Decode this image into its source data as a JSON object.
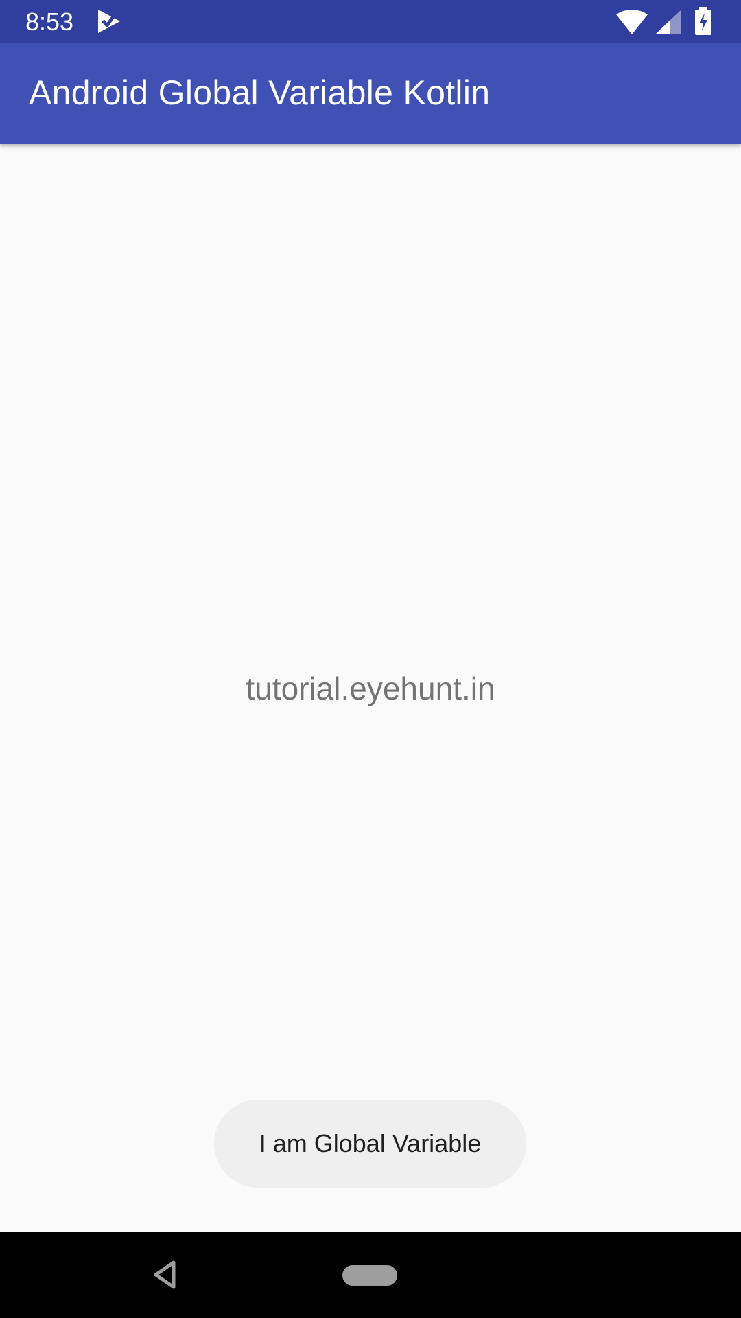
{
  "status_bar": {
    "time": "8:53",
    "icons": [
      "notification-check-icon",
      "wifi-icon",
      "cell-signal-icon",
      "battery-charging-icon"
    ],
    "background_color": "#303f9f"
  },
  "app_bar": {
    "title": "Android Global Variable Kotlin",
    "background_color": "#3f51b5"
  },
  "main": {
    "center_text": "tutorial.eyehunt.in"
  },
  "toast": {
    "message": "I am Global Variable"
  },
  "nav_bar": {
    "icons": [
      "back-icon",
      "home-pill-icon"
    ]
  }
}
